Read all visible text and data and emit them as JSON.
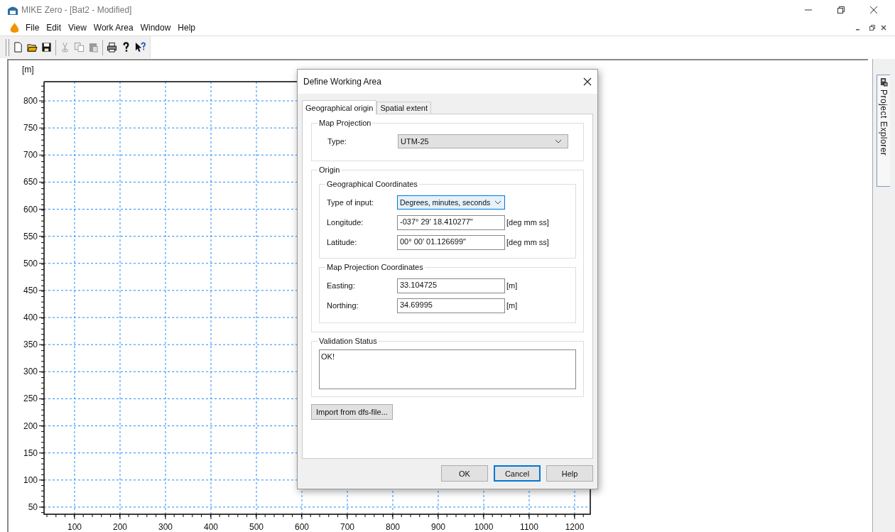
{
  "window": {
    "title": "MIKE Zero - [Bat2 - Modified]"
  },
  "menu": [
    {
      "label": "File"
    },
    {
      "label": "Edit"
    },
    {
      "label": "View"
    },
    {
      "label": "Work Area"
    },
    {
      "label": "Window"
    },
    {
      "label": "Help"
    }
  ],
  "toolbar": [
    {
      "kind": "new",
      "disabled": false
    },
    {
      "kind": "open",
      "disabled": false
    },
    {
      "kind": "save",
      "disabled": false
    },
    {
      "kind": "separator"
    },
    {
      "kind": "cut",
      "disabled": true
    },
    {
      "kind": "copy",
      "disabled": true
    },
    {
      "kind": "paste",
      "disabled": true
    },
    {
      "kind": "separator"
    },
    {
      "kind": "print",
      "disabled": false
    },
    {
      "kind": "help",
      "disabled": false
    },
    {
      "kind": "context-help",
      "disabled": false
    }
  ],
  "side_panel": {
    "tab": "Project Explorer"
  },
  "plot": {
    "unit": "[m]",
    "yticks": [
      "800",
      "750",
      "700",
      "650",
      "600",
      "550",
      "500",
      "450",
      "400",
      "350",
      "300",
      "250",
      "200",
      "150",
      "100",
      "50"
    ],
    "xticks": [
      "100",
      "200",
      "300",
      "400",
      "500",
      "600",
      "700",
      "800",
      "900",
      "1000",
      "1100",
      "1200"
    ]
  },
  "dialog": {
    "title": "Define Working Area",
    "tabs": [
      {
        "label": "Geographical origin",
        "selected": true
      },
      {
        "label": "Spatial extent",
        "selected": false
      }
    ],
    "map_projection": {
      "legend": "Map Projection",
      "label": "Type:",
      "value": "UTM-25"
    },
    "origin": {
      "legend": "Origin",
      "geographical": {
        "legend": "Geographical Coordinates",
        "input_label": "Type of input:",
        "input_value": "Degrees, minutes, seconds",
        "input_focused": true,
        "fields": [
          {
            "label": "Longitude:",
            "value": "-037° 29' 18.410277\"",
            "unit": "[deg mm ss]"
          },
          {
            "label": "Latitude:",
            "value": "00° 00' 01.126699\"",
            "unit": "[deg mm ss]"
          }
        ]
      },
      "projection": {
        "legend": "Map Projection Coordinates",
        "fields": [
          {
            "label": "Easting:",
            "value": "33.104725",
            "unit": "[m]"
          },
          {
            "label": "Northing:",
            "value": "34.69995",
            "unit": "[m]"
          }
        ]
      }
    },
    "validation": {
      "legend": "Validation Status",
      "text": "OK!"
    },
    "import_button": "Import from dfs-file...",
    "buttons": [
      {
        "label": "OK",
        "focused": false
      },
      {
        "label": "Cancel",
        "focused": true
      },
      {
        "label": "Help",
        "focused": false
      }
    ]
  }
}
